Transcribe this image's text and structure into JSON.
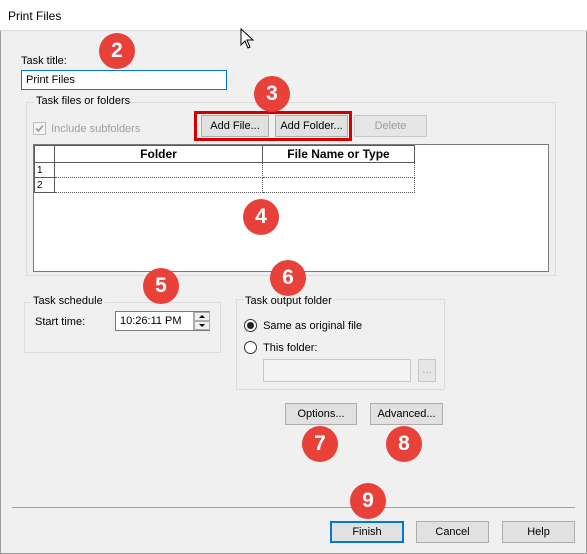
{
  "window": {
    "title": "Print Files"
  },
  "task_title": {
    "label": "Task title:",
    "value": "Print Files"
  },
  "files_group": {
    "caption": "Task files or folders",
    "include_subfolders": {
      "label": "Include subfolders",
      "checked": true,
      "enabled": false
    },
    "add_file": "Add File...",
    "add_folder": "Add Folder...",
    "delete": "Delete",
    "grid": {
      "columns": [
        "Folder",
        "File Name or Type"
      ],
      "rows": [
        {
          "num": "1",
          "folder": "",
          "file": ""
        },
        {
          "num": "2",
          "folder": "",
          "file": ""
        }
      ]
    }
  },
  "schedule": {
    "caption": "Task schedule",
    "start_label": "Start time:",
    "start_value": "10:26:11 PM"
  },
  "output": {
    "caption": "Task output folder",
    "same_as_original": "Same as original file",
    "this_folder": "This folder:",
    "folder_value": "",
    "browse": "..."
  },
  "options_button": "Options...",
  "advanced_button": "Advanced...",
  "footer": {
    "finish": "Finish",
    "cancel": "Cancel",
    "help": "Help"
  },
  "badges": [
    "2",
    "3",
    "4",
    "5",
    "6",
    "7",
    "8",
    "9"
  ],
  "colors": {
    "badge": "#e8413a",
    "highlight": "#d40000",
    "focus": "#0078d7"
  }
}
